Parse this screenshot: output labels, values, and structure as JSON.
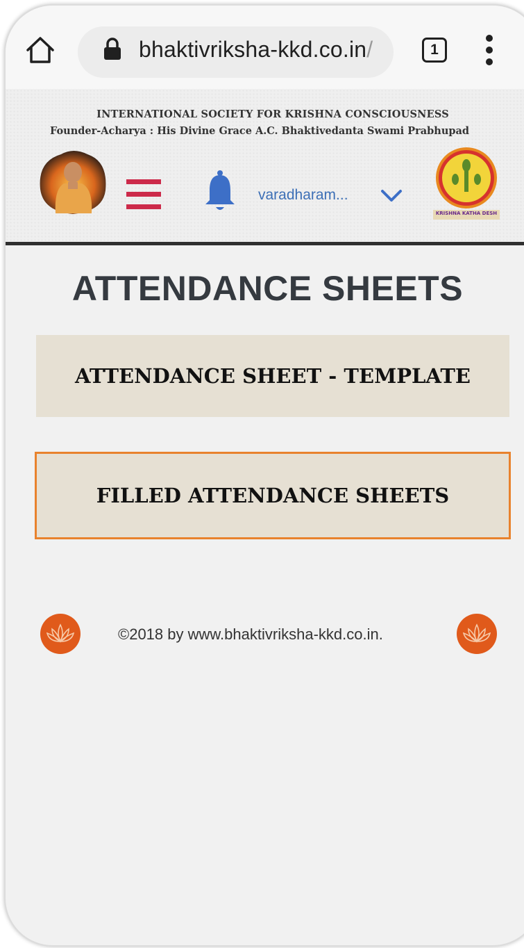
{
  "browser": {
    "url": "bhaktivriksha-kkd.co.in",
    "url_suffix": "/",
    "tab_count": "1",
    "icons": [
      "home-icon",
      "lock-icon",
      "tabs-icon",
      "more-vert-icon"
    ]
  },
  "header": {
    "org_name": "INTERNATIONAL SOCIETY FOR KRISHNA CONSCIOUSNESS",
    "founder_line": "Founder-Acharya : His Divine Grace A.C. Bhaktivedanta Swami Prabhupad",
    "username": "varadharam...",
    "right_logo_caption": "KRISHNA KATHA DESH",
    "icons": [
      "menu-icon",
      "bell-icon",
      "chevron-down-icon"
    ]
  },
  "main": {
    "title": "ATTENDANCE SHEETS",
    "buttons": [
      {
        "label": "ATTENDANCE SHEET - TEMPLATE"
      },
      {
        "label": "FILLED ATTENDANCE SHEETS"
      }
    ]
  },
  "footer": {
    "copyright": "©2018 by www.bhaktivriksha-kkd.co.in."
  },
  "colors": {
    "accent_orange": "#e05a1b",
    "button_bg": "#e6e0d3",
    "button_border": "#e8822d",
    "hamburger": "#cc2a4a",
    "bell": "#3d6fc7",
    "title": "#353a40"
  }
}
